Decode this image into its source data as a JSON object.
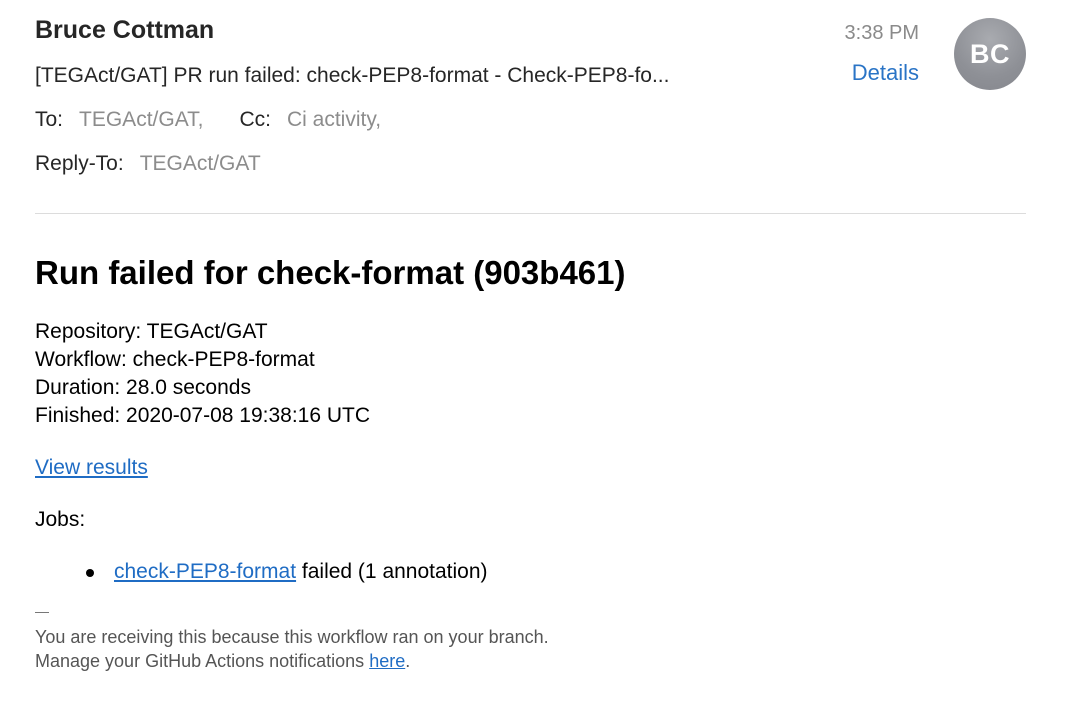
{
  "header": {
    "sender_name": "Bruce Cottman",
    "subject": "[TEGAct/GAT] PR run failed: check-PEP8-format - Check-PEP8-fo...",
    "time": "3:38 PM",
    "details_label": "Details",
    "avatar_initials": "BC",
    "to_label": "To:",
    "to_value": "TEGAct/GAT,",
    "cc_label": "Cc:",
    "cc_value": "Ci activity,",
    "reply_to_label": "Reply-To:",
    "reply_to_value": "TEGAct/GAT"
  },
  "body": {
    "title": "Run failed for check-format (903b461)",
    "repository": "Repository: TEGAct/GAT",
    "workflow": "Workflow: check-PEP8-format",
    "duration": "Duration: 28.0 seconds",
    "finished": "Finished: 2020-07-08 19:38:16 UTC",
    "view_results_label": "View results",
    "jobs_label": "Jobs:",
    "jobs": [
      {
        "link_label": "check-PEP8-format",
        "status_text": " failed (1 annotation)"
      }
    ]
  },
  "footer": {
    "line1": "You are receiving this because this workflow ran on your branch.",
    "line2_prefix": "Manage your GitHub Actions notifications ",
    "line2_link": "here",
    "line2_suffix": "."
  },
  "colors": {
    "link": "#1f6cc4",
    "details_link": "#2a74c6",
    "muted_text": "#8c8c8c",
    "avatar_bg": "#8e9096"
  }
}
